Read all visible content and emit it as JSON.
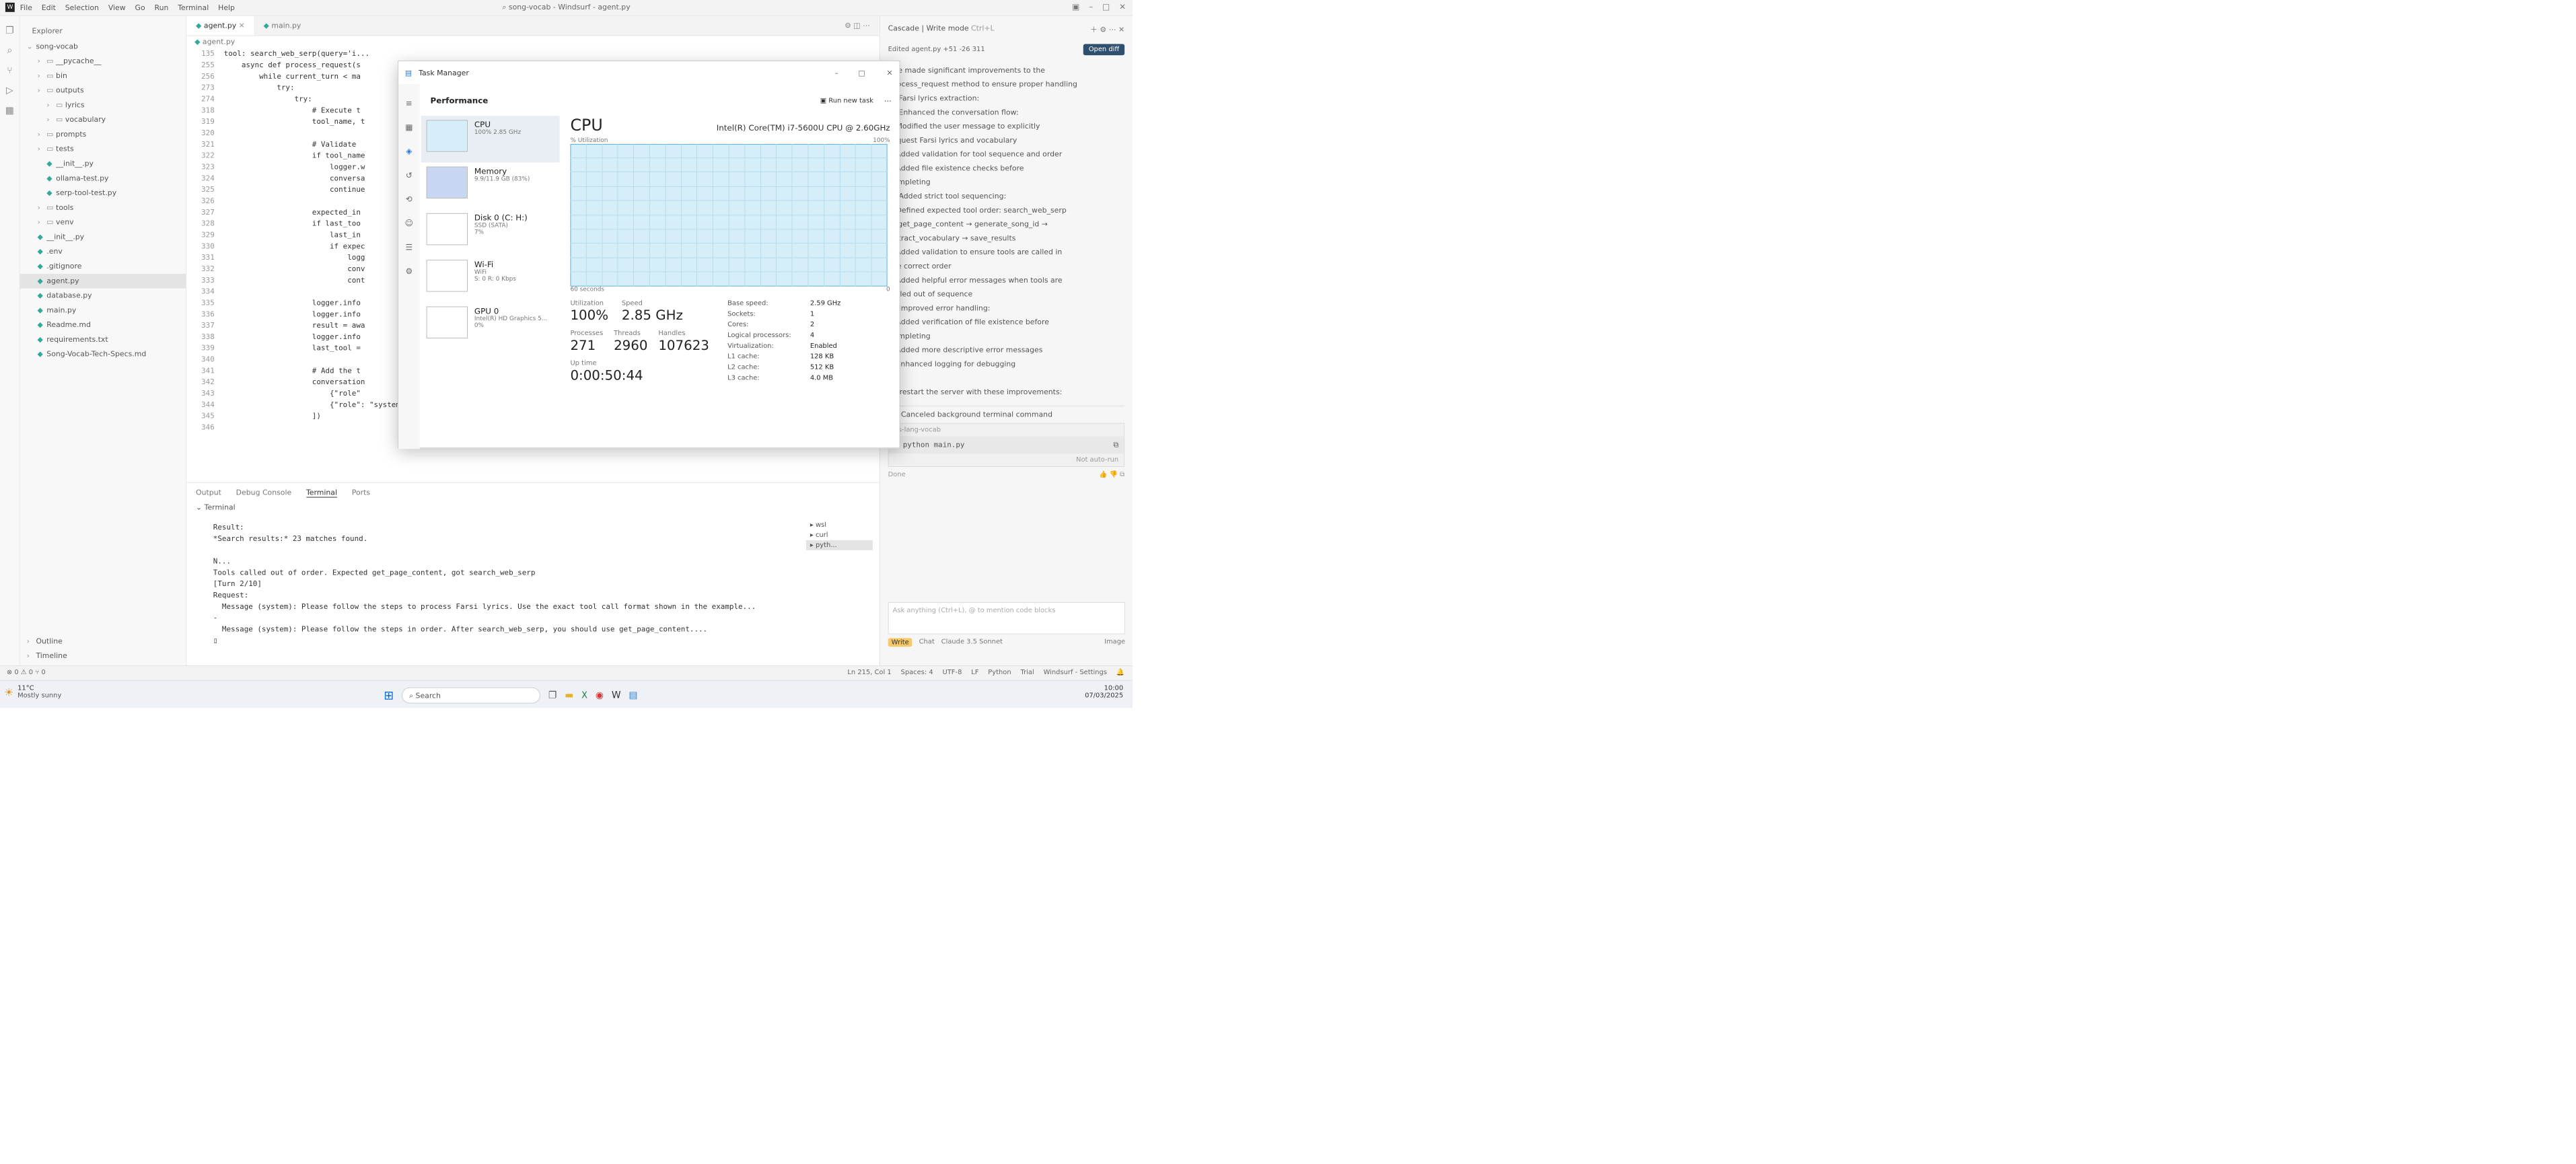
{
  "window_title": "song-vocab - Windsurf - agent.py",
  "menu": [
    "File",
    "Edit",
    "Selection",
    "View",
    "Go",
    "Run",
    "Terminal",
    "Help"
  ],
  "explorer": {
    "title": "Explorer",
    "root": "song-vocab",
    "items": [
      {
        "label": "__pycache__",
        "type": "folder",
        "level": 1
      },
      {
        "label": "bin",
        "type": "folder",
        "level": 1
      },
      {
        "label": "outputs",
        "type": "folder",
        "level": 1
      },
      {
        "label": "lyrics",
        "type": "folder",
        "level": 2
      },
      {
        "label": "vocabulary",
        "type": "folder",
        "level": 2
      },
      {
        "label": "prompts",
        "type": "folder",
        "level": 1
      },
      {
        "label": "tests",
        "type": "folder",
        "level": 1
      },
      {
        "label": "__init__.py",
        "type": "file",
        "level": 2
      },
      {
        "label": "ollama-test.py",
        "type": "file",
        "level": 2
      },
      {
        "label": "serp-tool-test.py",
        "type": "file",
        "level": 2
      },
      {
        "label": "tools",
        "type": "folder",
        "level": 1
      },
      {
        "label": "venv",
        "type": "folder",
        "level": 1
      },
      {
        "label": "__init__.py",
        "type": "file",
        "level": 1
      },
      {
        "label": ".env",
        "type": "file",
        "level": 1
      },
      {
        "label": ".gitignore",
        "type": "file",
        "level": 1
      },
      {
        "label": "agent.py",
        "type": "file",
        "level": 1,
        "selected": true
      },
      {
        "label": "database.py",
        "type": "file",
        "level": 1
      },
      {
        "label": "main.py",
        "type": "file",
        "level": 1
      },
      {
        "label": "Readme.md",
        "type": "file",
        "level": 1
      },
      {
        "label": "requirements.txt",
        "type": "file",
        "level": 1
      },
      {
        "label": "Song-Vocab-Tech-Specs.md",
        "type": "file",
        "level": 1
      }
    ],
    "outline": "Outline",
    "timeline": "Timeline"
  },
  "editor": {
    "tabs": [
      "agent.py",
      "main.py"
    ],
    "breadcrumb": "agent.py",
    "lines": [
      {
        "n": "135",
        "t": "tool: search_web_serp(query='i..."
      },
      {
        "n": "255",
        "t": "    async def process_request(s"
      },
      {
        "n": "256",
        "t": "        while current_turn < ma"
      },
      {
        "n": "273",
        "t": "            try:"
      },
      {
        "n": "274",
        "t": "                try:"
      },
      {
        "n": "318",
        "t": "                    # Execute t"
      },
      {
        "n": "319",
        "t": "                    tool_name, t"
      },
      {
        "n": "320",
        "t": ""
      },
      {
        "n": "321",
        "t": "                    # Validate"
      },
      {
        "n": "322",
        "t": "                    if tool_name"
      },
      {
        "n": "323",
        "t": "                        logger.w"
      },
      {
        "n": "324",
        "t": "                        conversa"
      },
      {
        "n": "325",
        "t": "                        continue"
      },
      {
        "n": "326",
        "t": ""
      },
      {
        "n": "327",
        "t": "                    expected_in"
      },
      {
        "n": "328",
        "t": "                    if last_too"
      },
      {
        "n": "329",
        "t": "                        last_in"
      },
      {
        "n": "330",
        "t": "                        if expec"
      },
      {
        "n": "331",
        "t": "                            logg"
      },
      {
        "n": "332",
        "t": "                            conv"
      },
      {
        "n": "333",
        "t": "                            cont"
      },
      {
        "n": "334",
        "t": ""
      },
      {
        "n": "335",
        "t": "                    logger.info"
      },
      {
        "n": "336",
        "t": "                    logger.info"
      },
      {
        "n": "337",
        "t": "                    result = awa"
      },
      {
        "n": "338",
        "t": "                    logger.info"
      },
      {
        "n": "339",
        "t": "                    last_tool ="
      },
      {
        "n": "340",
        "t": ""
      },
      {
        "n": "341",
        "t": "                    # Add the t"
      },
      {
        "n": "342",
        "t": "                    conversation"
      },
      {
        "n": "343",
        "t": "                        {\"role\""
      },
      {
        "n": "344",
        "t": "                        {\"role\": \"system\", \"content\": f\"Tool {tool_name} result: {json.dumps(result)}\""
      },
      {
        "n": "345",
        "t": "                    ])"
      },
      {
        "n": "346",
        "t": ""
      }
    ]
  },
  "panel": {
    "tabs": [
      "Output",
      "Debug Console",
      "Terminal",
      "Ports"
    ],
    "active_tab": "Terminal",
    "terminal_label": "Terminal",
    "lines": [
      "Result:",
      "*Search results:* 23 matches found.",
      "",
      "N...",
      "Tools called out of order. Expected get_page_content, got search_web_serp",
      "[Turn 2/10]",
      "Request:",
      "  Message (system): Please follow the steps to process Farsi lyrics. Use the exact tool call format shown in the example...",
      "-",
      "  Message (system): Please follow the steps in order. After search_web_serp, you should use get_page_content...."
    ],
    "sessions": [
      "wsl",
      "curl",
      "pyth..."
    ]
  },
  "cascade": {
    "title": "Cascade | Write mode",
    "shortcut": "Ctrl+L",
    "edited": "Edited  agent.py  +51 -26 311",
    "open_diff": "Open diff",
    "messages": [
      "I've made significant improvements to the",
      "process_request method to ensure proper handling",
      "of Farsi lyrics extraction:",
      "1. Enhanced the conversation flow:",
      "• Modified the user message to explicitly",
      "  request Farsi lyrics and vocabulary",
      "• Added validation for tool sequence and order",
      "• Added file existence checks before",
      "  completing",
      "2. Added strict tool sequencing:",
      "• Defined expected tool order: search_web_serp",
      "  → get_page_content → generate_song_id →",
      "  extract_vocabulary → save_results",
      "• Added validation to ensure tools are called in",
      "  the correct order",
      "• Added helpful error messages when tools are",
      "  called out of sequence",
      "3. Improved error handling:",
      "• Added verification of file existence before",
      "  completing",
      "• Added more descriptive error messages",
      "• Enhanced logging for debugging",
      "",
      "To restart the server with these improvements:"
    ],
    "cancelled": "Canceled background terminal command",
    "cmd_dir": "ps-lang-vocab",
    "command": "> python main.py",
    "not_auto_run": "Not auto-run",
    "done": "Done",
    "input_placeholder": "Ask anything (Ctrl+L), @ to mention code blocks",
    "write": "Write",
    "chat": "Chat",
    "model": "Claude 3.5 Sonnet",
    "image": "Image"
  },
  "status": {
    "left": "⊗ 0  ⚠ 0   ⑂ 0",
    "ln": "Ln 215, Col 1",
    "spaces": "Spaces: 4",
    "enc": "UTF-8",
    "eol": "LF",
    "lang": "Python",
    "trial": "Trial",
    "settings": "Windsurf - Settings"
  },
  "taskbar": {
    "weather_temp": "11°C",
    "weather_desc": "Mostly sunny",
    "search": "Search",
    "time": "10:00",
    "date": "07/03/2025"
  },
  "task_manager": {
    "title": "Task Manager",
    "section": "Performance",
    "run_new_task": "Run new task",
    "devices": [
      {
        "name": "CPU",
        "sub": "100%  2.85 GHz"
      },
      {
        "name": "Memory",
        "sub": "9.9/11.9 GB (83%)"
      },
      {
        "name": "Disk 0 (C: H:)",
        "sub": "SSD (SATA)",
        "sub2": "7%"
      },
      {
        "name": "Wi-Fi",
        "sub": "WiFi",
        "sub2": "S: 0  R: 0 Kbps"
      },
      {
        "name": "GPU 0",
        "sub": "Intel(R) HD Graphics 5...",
        "sub2": "0%"
      }
    ],
    "heading": "CPU",
    "cpu_model": "Intel(R) Core(TM) i7-5600U CPU @ 2.60GHz",
    "util_label": "% Utilization",
    "util_max": "100%",
    "seconds_label": "60 seconds",
    "zero": "0",
    "stats": [
      {
        "label": "Utilization",
        "value": "100%"
      },
      {
        "label": "Speed",
        "value": "2.85 GHz"
      },
      {
        "label": "Processes",
        "value": "271"
      },
      {
        "label": "Threads",
        "value": "2960"
      },
      {
        "label": "Handles",
        "value": "107623"
      }
    ],
    "uptime_label": "Up time",
    "uptime": "0:00:50:44",
    "details": [
      {
        "k": "Base speed:",
        "v": "2.59 GHz"
      },
      {
        "k": "Sockets:",
        "v": "1"
      },
      {
        "k": "Cores:",
        "v": "2"
      },
      {
        "k": "Logical processors:",
        "v": "4"
      },
      {
        "k": "Virtualization:",
        "v": "Enabled"
      },
      {
        "k": "L1 cache:",
        "v": "128 KB"
      },
      {
        "k": "L2 cache:",
        "v": "512 KB"
      },
      {
        "k": "L3 cache:",
        "v": "4.0 MB"
      }
    ],
    "colors": {
      "cpu_fill": "#d6eef8",
      "cpu_line": "#4aa8d6",
      "mem_fill": "#c9d6f2"
    }
  }
}
